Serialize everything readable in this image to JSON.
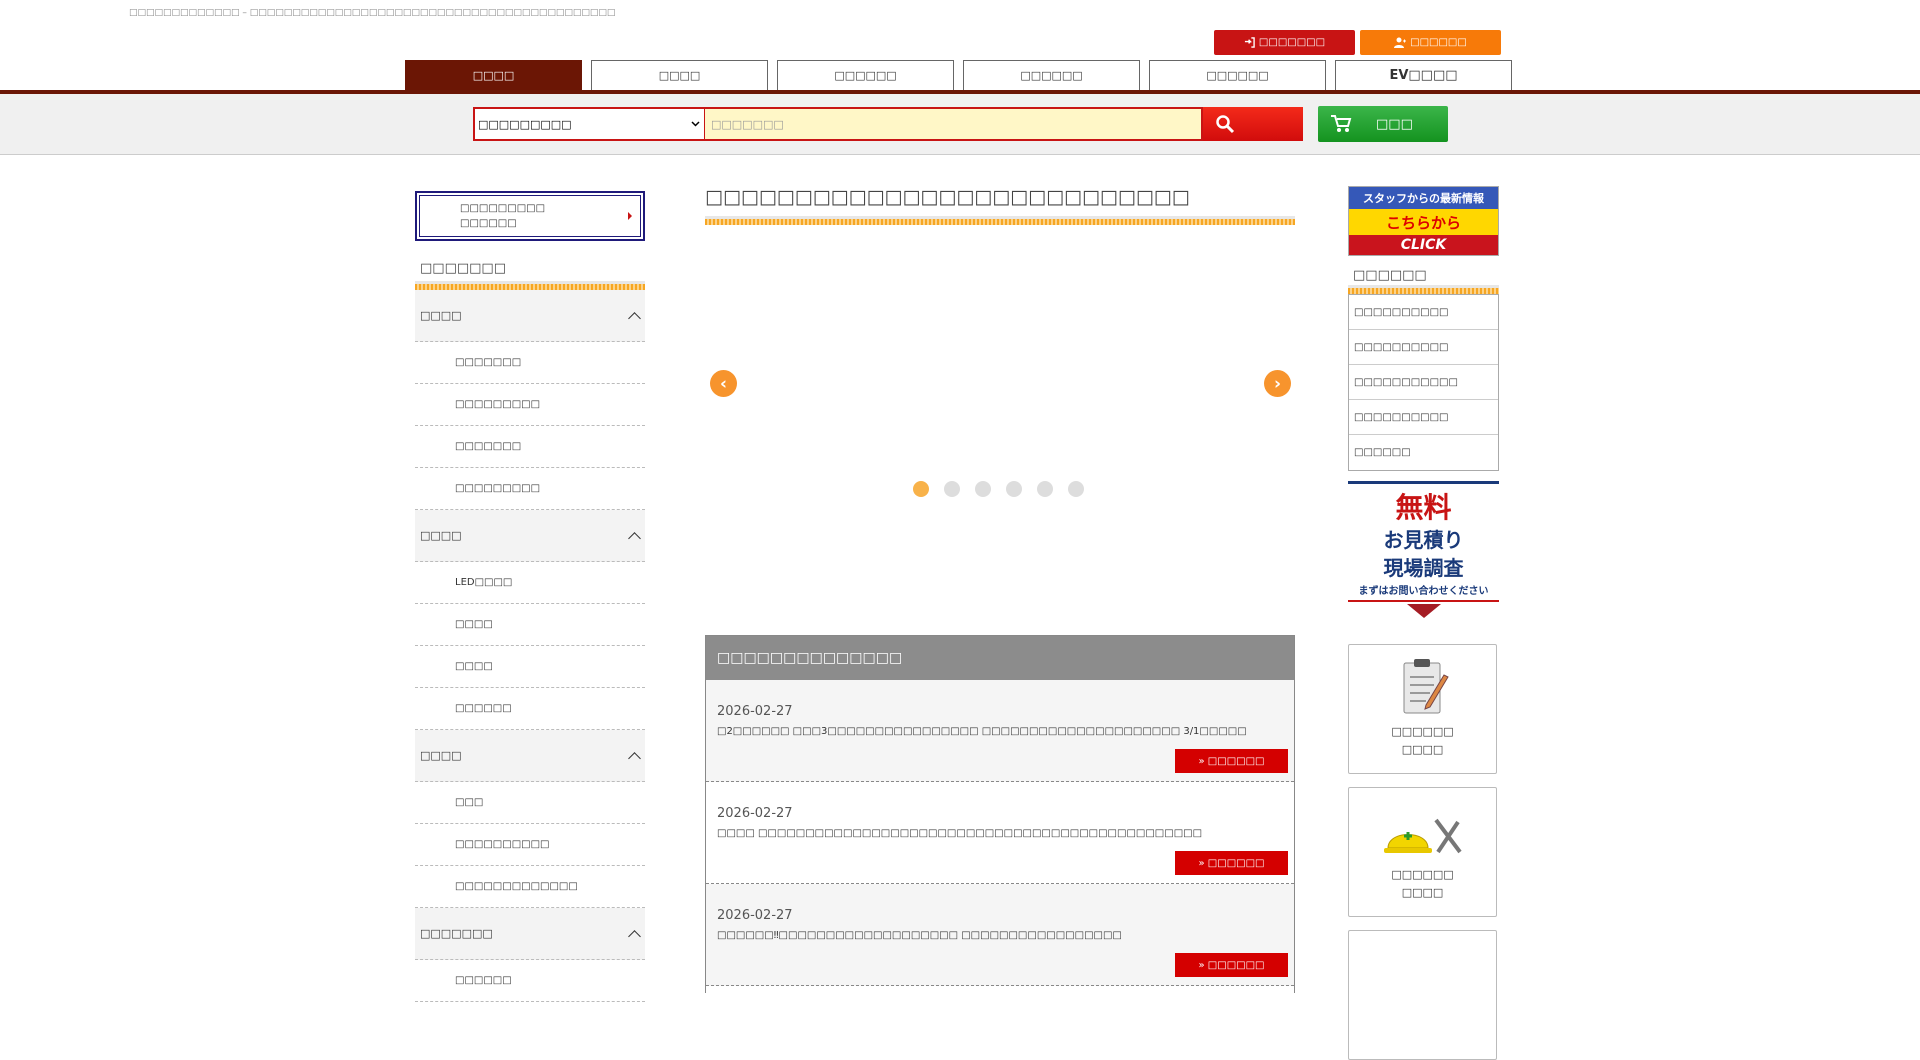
{
  "header": {
    "tagline": "□□□□□□□□□□□□□ – □□□□□□□□□□□□□□□□□□□□□□□□□□□□□□□□□□□□□□□□□□□",
    "login_label": "□□□□□□□",
    "register_label": "□□□□□□"
  },
  "nav": {
    "tabs": [
      {
        "label": "□□□□"
      },
      {
        "label": "□□□□"
      },
      {
        "label": "□□□□□□"
      },
      {
        "label": "□□□□□□"
      },
      {
        "label": "□□□□□□"
      },
      {
        "label": "EV□□□□"
      }
    ]
  },
  "search": {
    "category": "□□□□□□□□□",
    "placeholder": "□□□□□□□",
    "cart_label": "□□□"
  },
  "left": {
    "contact_line1": "□□□□□□□□□",
    "contact_line2": "□□□□□□",
    "section_title": "□□□□□□□",
    "categories": [
      {
        "label": "□□□□",
        "items": [
          "□□□□□□□",
          "□□□□□□□□□",
          "□□□□□□□",
          "□□□□□□□□□"
        ]
      },
      {
        "label": "□□□□",
        "items": [
          "LED□□□□",
          "□□□□",
          "□□□□",
          "□□□□□□"
        ]
      },
      {
        "label": "□□□□",
        "items": [
          "□□□",
          "□□□□□□□□□□",
          "□□□□□□□□□□□□□"
        ]
      },
      {
        "label": "□□□□□□□",
        "items": [
          "□□□□□□"
        ]
      }
    ]
  },
  "main": {
    "title": "□□□□□□□□□□□□□□□□□□□□□□□□□□□",
    "news_title": "□□□□□□□□□□□□□□",
    "news": [
      {
        "date": "2026-02-27",
        "text": "□2□□□□□□ □□□3□□□□□□□□□□□□□□□□ □□□□□□□□□□□□□□□□□□□□□ 3/1□□□□□",
        "more": "□□□□□□"
      },
      {
        "date": "2026-02-27",
        "text": "□□□□ □□□□□□□□□□□□□□□□□□□□□□□□□□□□□□□□□□□□□□□□□□□□□□□",
        "more": "□□□□□□"
      },
      {
        "date": "2026-02-27",
        "text": "□□□□□□‼□□□□□□□□□□□□□□□□□□□ □□□□□□□□□□□□□□□□□",
        "more": "□□□□□□"
      }
    ]
  },
  "right": {
    "staff_top": "スタッフからの最新情報",
    "staff_mid": "こちらから",
    "staff_bot": "CLICK",
    "links_title": "□□□□□□",
    "links": [
      "□□□□□□□□□□",
      "□□□□□□□□□□",
      "□□□□□□□□□□□",
      "□□□□□□□□□□",
      "□□□□□□"
    ],
    "free_big": "無料",
    "free_line1": "お見積り",
    "free_line2": "現場調査",
    "free_small": "まずはお問い合わせください",
    "card1_line1": "□□□□□□",
    "card1_line2": "□□□□",
    "card2_line1": "□□□□□□",
    "card2_line2": "□□□□"
  },
  "colors": {
    "nav_active": "#6b1605",
    "accent_red": "#c81414",
    "accent_orange": "#f77a09",
    "cart_green": "#14931f"
  }
}
